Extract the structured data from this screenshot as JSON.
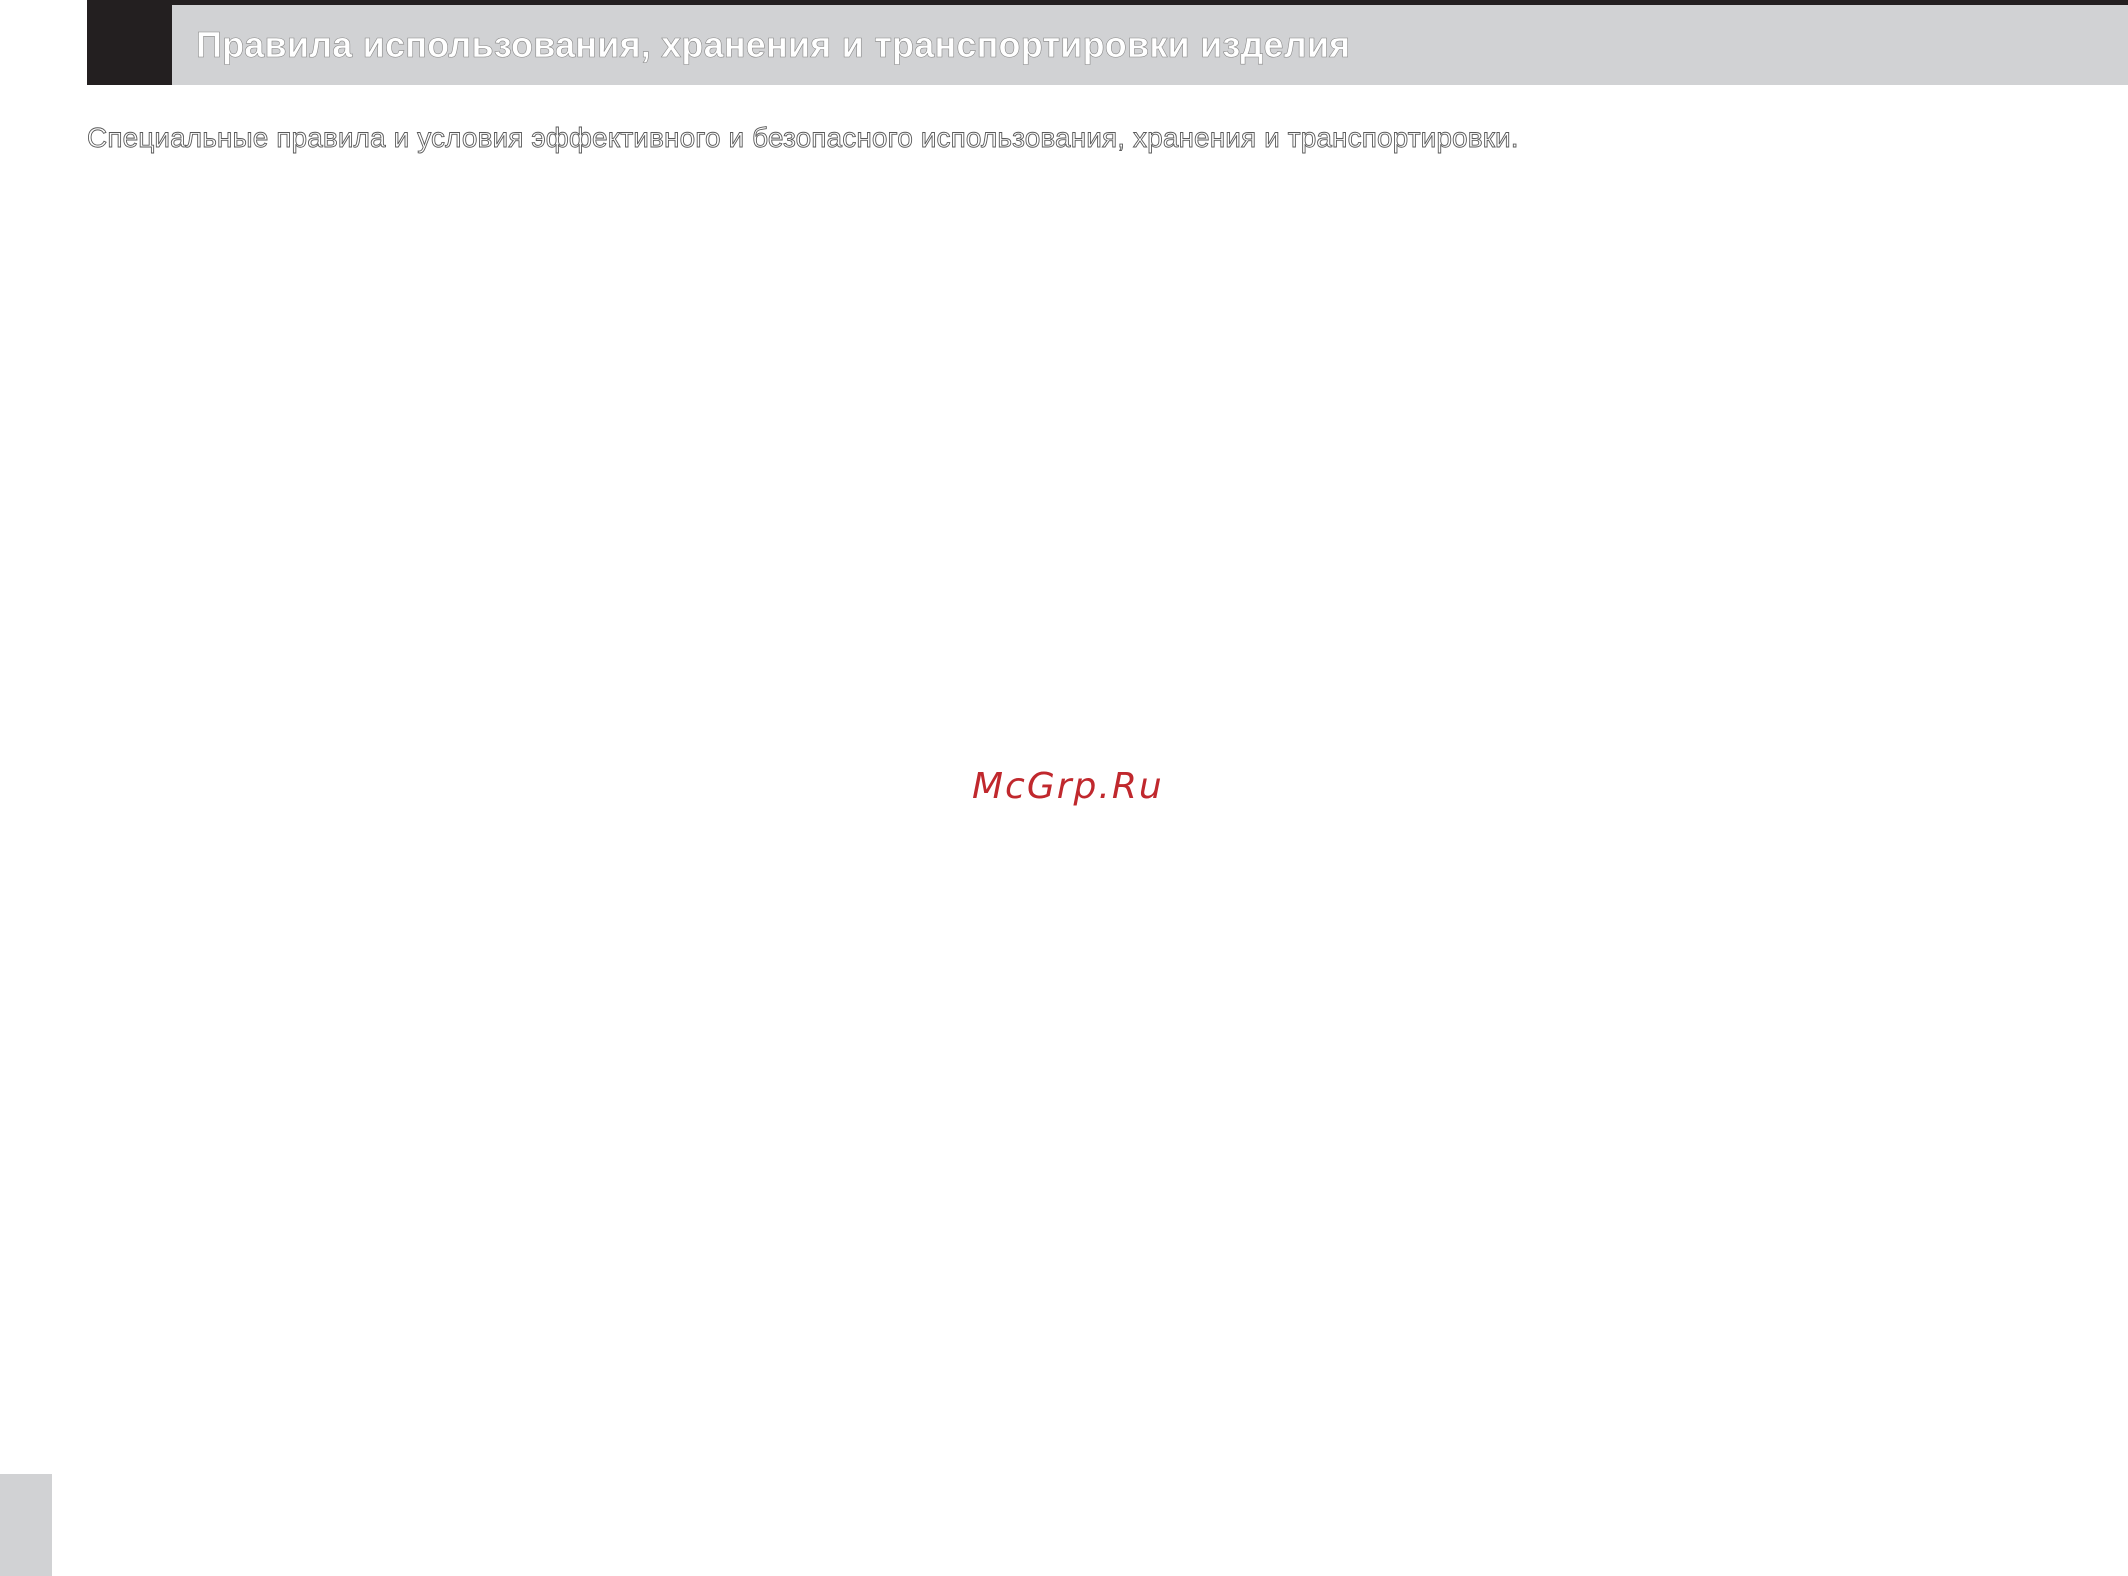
{
  "header": {
    "title": "Правила использования, хранения и транспортировки изделия"
  },
  "content": {
    "intro": "Специальные правила и условия эффективного и безопасного использования, хранения и транспортировки."
  },
  "watermark": {
    "text": "McGrp.Ru"
  },
  "colors": {
    "header_block": "#231f20",
    "header_bar": "#d1d2d4",
    "watermark": "#c0282d",
    "page_tab": "#d1d2d4"
  }
}
